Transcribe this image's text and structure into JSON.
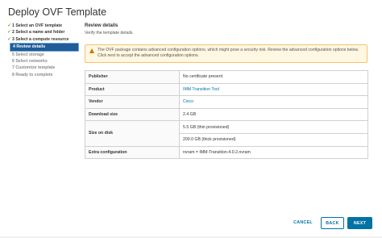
{
  "dialog": {
    "title": "Deploy OVF Template"
  },
  "steps": [
    {
      "label": "1 Select an OVF template",
      "state": "done"
    },
    {
      "label": "2 Select a name and folder",
      "state": "done"
    },
    {
      "label": "3 Select a compute resource",
      "state": "done"
    },
    {
      "label": "4 Review details",
      "state": "active"
    },
    {
      "label": "5 Select storage",
      "state": "pending"
    },
    {
      "label": "6 Select networks",
      "state": "pending"
    },
    {
      "label": "7 Customize template",
      "state": "pending"
    },
    {
      "label": "8 Ready to complete",
      "state": "pending"
    }
  ],
  "main": {
    "section_title": "Review details",
    "section_subtitle": "Verify the template details.",
    "warning": "The OVF package contains advanced configuration options, which might pose a security risk. Review the advanced configuration options below. Click next to accept the advanced configuration options."
  },
  "details": {
    "publisher_label": "Publisher",
    "publisher_value": "No certificate present",
    "product_label": "Product",
    "product_value": "IMM Transition Tool",
    "vendor_label": "Vendor",
    "vendor_value": "Cisco",
    "download_label": "Download size",
    "download_value": "2.4 GB",
    "disk_label": "Size on disk",
    "disk_thin": "5.5 GB (thin provisioned)",
    "disk_thick": "200.0 GB (thick provisioned)",
    "extra_label": "Extra configuration",
    "extra_value": "nvram = IMM-Transition-4.0.2.nvram"
  },
  "footer": {
    "cancel_label": "CANCEL",
    "back_label": "BACK",
    "next_label": "NEXT"
  },
  "colors": {
    "accent": "#0072a3",
    "active_step": "#1f5c99",
    "check": "#2f8400",
    "warning_bg": "#fff7e1"
  }
}
